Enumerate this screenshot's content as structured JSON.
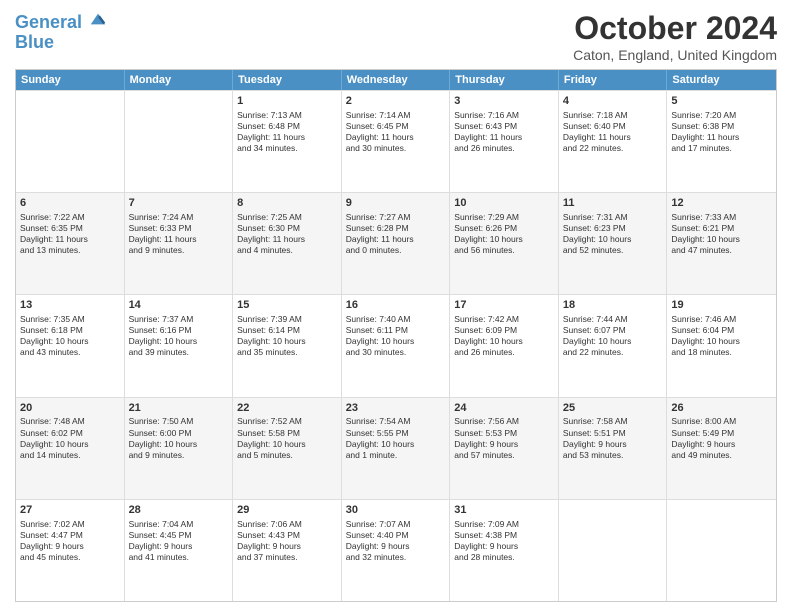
{
  "header": {
    "logo_line1": "General",
    "logo_line2": "Blue",
    "month_title": "October 2024",
    "location": "Caton, England, United Kingdom"
  },
  "days_of_week": [
    "Sunday",
    "Monday",
    "Tuesday",
    "Wednesday",
    "Thursday",
    "Friday",
    "Saturday"
  ],
  "weeks": [
    [
      {
        "day": "",
        "details": ""
      },
      {
        "day": "",
        "details": ""
      },
      {
        "day": "1",
        "details": "Sunrise: 7:13 AM\nSunset: 6:48 PM\nDaylight: 11 hours\nand 34 minutes."
      },
      {
        "day": "2",
        "details": "Sunrise: 7:14 AM\nSunset: 6:45 PM\nDaylight: 11 hours\nand 30 minutes."
      },
      {
        "day": "3",
        "details": "Sunrise: 7:16 AM\nSunset: 6:43 PM\nDaylight: 11 hours\nand 26 minutes."
      },
      {
        "day": "4",
        "details": "Sunrise: 7:18 AM\nSunset: 6:40 PM\nDaylight: 11 hours\nand 22 minutes."
      },
      {
        "day": "5",
        "details": "Sunrise: 7:20 AM\nSunset: 6:38 PM\nDaylight: 11 hours\nand 17 minutes."
      }
    ],
    [
      {
        "day": "6",
        "details": "Sunrise: 7:22 AM\nSunset: 6:35 PM\nDaylight: 11 hours\nand 13 minutes."
      },
      {
        "day": "7",
        "details": "Sunrise: 7:24 AM\nSunset: 6:33 PM\nDaylight: 11 hours\nand 9 minutes."
      },
      {
        "day": "8",
        "details": "Sunrise: 7:25 AM\nSunset: 6:30 PM\nDaylight: 11 hours\nand 4 minutes."
      },
      {
        "day": "9",
        "details": "Sunrise: 7:27 AM\nSunset: 6:28 PM\nDaylight: 11 hours\nand 0 minutes."
      },
      {
        "day": "10",
        "details": "Sunrise: 7:29 AM\nSunset: 6:26 PM\nDaylight: 10 hours\nand 56 minutes."
      },
      {
        "day": "11",
        "details": "Sunrise: 7:31 AM\nSunset: 6:23 PM\nDaylight: 10 hours\nand 52 minutes."
      },
      {
        "day": "12",
        "details": "Sunrise: 7:33 AM\nSunset: 6:21 PM\nDaylight: 10 hours\nand 47 minutes."
      }
    ],
    [
      {
        "day": "13",
        "details": "Sunrise: 7:35 AM\nSunset: 6:18 PM\nDaylight: 10 hours\nand 43 minutes."
      },
      {
        "day": "14",
        "details": "Sunrise: 7:37 AM\nSunset: 6:16 PM\nDaylight: 10 hours\nand 39 minutes."
      },
      {
        "day": "15",
        "details": "Sunrise: 7:39 AM\nSunset: 6:14 PM\nDaylight: 10 hours\nand 35 minutes."
      },
      {
        "day": "16",
        "details": "Sunrise: 7:40 AM\nSunset: 6:11 PM\nDaylight: 10 hours\nand 30 minutes."
      },
      {
        "day": "17",
        "details": "Sunrise: 7:42 AM\nSunset: 6:09 PM\nDaylight: 10 hours\nand 26 minutes."
      },
      {
        "day": "18",
        "details": "Sunrise: 7:44 AM\nSunset: 6:07 PM\nDaylight: 10 hours\nand 22 minutes."
      },
      {
        "day": "19",
        "details": "Sunrise: 7:46 AM\nSunset: 6:04 PM\nDaylight: 10 hours\nand 18 minutes."
      }
    ],
    [
      {
        "day": "20",
        "details": "Sunrise: 7:48 AM\nSunset: 6:02 PM\nDaylight: 10 hours\nand 14 minutes."
      },
      {
        "day": "21",
        "details": "Sunrise: 7:50 AM\nSunset: 6:00 PM\nDaylight: 10 hours\nand 9 minutes."
      },
      {
        "day": "22",
        "details": "Sunrise: 7:52 AM\nSunset: 5:58 PM\nDaylight: 10 hours\nand 5 minutes."
      },
      {
        "day": "23",
        "details": "Sunrise: 7:54 AM\nSunset: 5:55 PM\nDaylight: 10 hours\nand 1 minute."
      },
      {
        "day": "24",
        "details": "Sunrise: 7:56 AM\nSunset: 5:53 PM\nDaylight: 9 hours\nand 57 minutes."
      },
      {
        "day": "25",
        "details": "Sunrise: 7:58 AM\nSunset: 5:51 PM\nDaylight: 9 hours\nand 53 minutes."
      },
      {
        "day": "26",
        "details": "Sunrise: 8:00 AM\nSunset: 5:49 PM\nDaylight: 9 hours\nand 49 minutes."
      }
    ],
    [
      {
        "day": "27",
        "details": "Sunrise: 7:02 AM\nSunset: 4:47 PM\nDaylight: 9 hours\nand 45 minutes."
      },
      {
        "day": "28",
        "details": "Sunrise: 7:04 AM\nSunset: 4:45 PM\nDaylight: 9 hours\nand 41 minutes."
      },
      {
        "day": "29",
        "details": "Sunrise: 7:06 AM\nSunset: 4:43 PM\nDaylight: 9 hours\nand 37 minutes."
      },
      {
        "day": "30",
        "details": "Sunrise: 7:07 AM\nSunset: 4:40 PM\nDaylight: 9 hours\nand 32 minutes."
      },
      {
        "day": "31",
        "details": "Sunrise: 7:09 AM\nSunset: 4:38 PM\nDaylight: 9 hours\nand 28 minutes."
      },
      {
        "day": "",
        "details": ""
      },
      {
        "day": "",
        "details": ""
      }
    ]
  ]
}
